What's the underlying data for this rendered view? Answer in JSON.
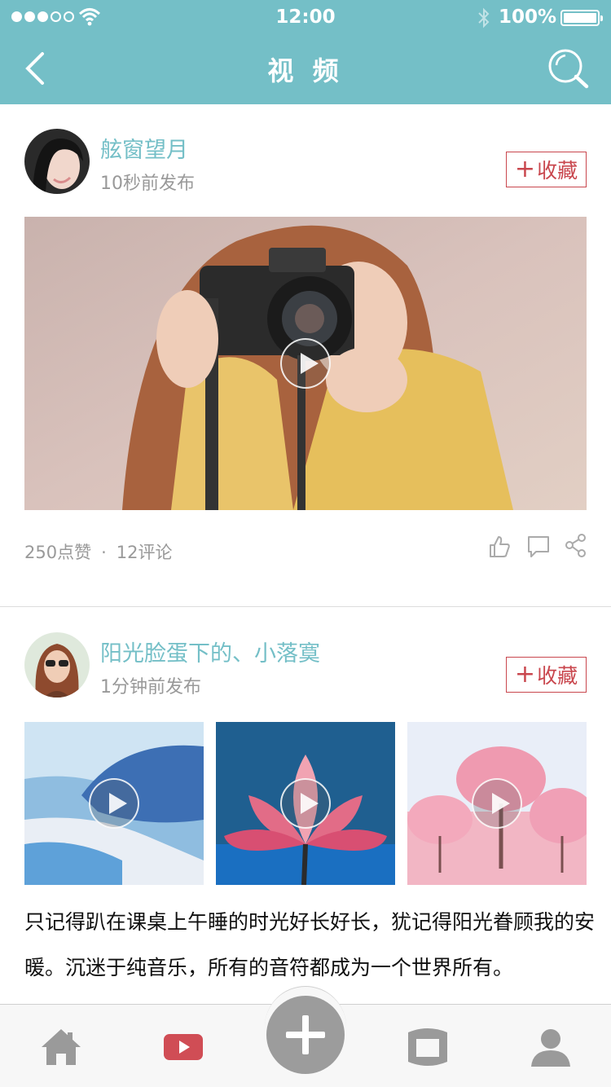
{
  "status_bar": {
    "time": "12:00",
    "battery": "100%"
  },
  "header": {
    "title": "视 频"
  },
  "posts": [
    {
      "author": "舷窗望月",
      "time": "10秒前发布",
      "favorite_label": "收藏",
      "likes": "250点赞",
      "separator": "·",
      "comments": "12评论"
    },
    {
      "author": "阳光脸蛋下的、小落寞",
      "time": "1分钟前发布",
      "favorite_label": "收藏",
      "text": "只记得趴在课桌上午睡的时光好长好长，犹记得阳光眷顾我的安暖。沉迷于纯音乐，所有的音符都成为一个世界所有。"
    }
  ],
  "tabbar": {
    "items": [
      "home-icon",
      "video-icon",
      "add-icon",
      "subway-icon",
      "user-icon"
    ],
    "active_color": "#d04d55",
    "inactive_color": "#9a9a9a"
  },
  "colors": {
    "accent": "#74bfc7",
    "favorite": "#c9474e"
  }
}
